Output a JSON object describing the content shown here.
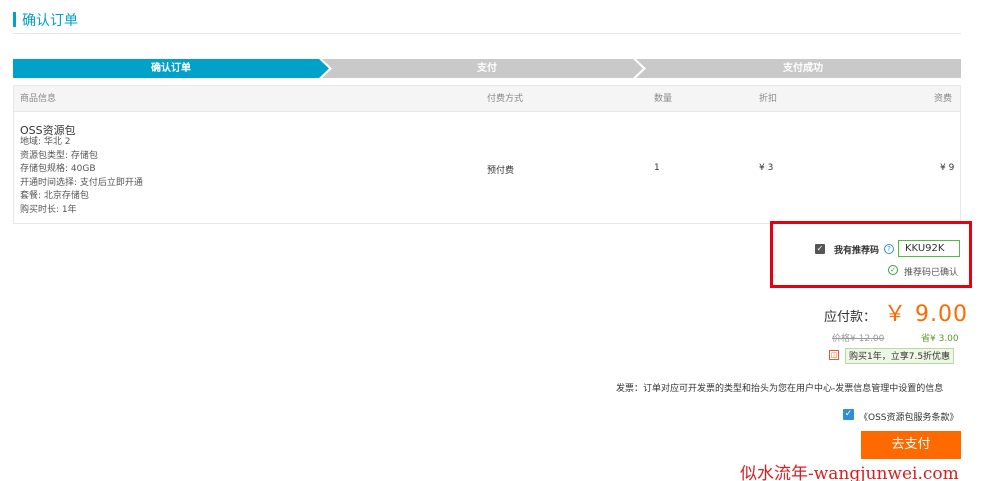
{
  "header": {
    "title": "确认订单"
  },
  "steps": [
    {
      "label": "确认订单",
      "active": true
    },
    {
      "label": "支付",
      "active": false
    },
    {
      "label": "支付成功",
      "active": false
    }
  ],
  "colors": {
    "accent": "#00a2ca",
    "step_inactive": "#c9c9c9",
    "pay_orange": "#ff6a00",
    "highlight_red": "#e60012",
    "input_green": "#58b74b",
    "watermark_red": "#d62020"
  },
  "table": {
    "headers": {
      "product": "商品信息",
      "payment_method": "付费方式",
      "quantity": "数量",
      "discount": "折扣",
      "fee": "资费"
    },
    "row": {
      "name": "OSS资源包",
      "specs": [
        "地域: 华北 2",
        "资源包类型: 存储包",
        "存储包规格: 40GB",
        "开通时间选择: 支付后立即开通",
        "套餐: 北京存储包",
        "购买时长: 1年"
      ],
      "payment_method": "预付费",
      "quantity": "1",
      "discount": "¥ 3",
      "fee": "¥ 9"
    }
  },
  "referral": {
    "label": "我有推荐码",
    "code": "KKU92K",
    "confirmed_text": "推荐码已确认",
    "checked": true
  },
  "summary": {
    "pay_label": "应付款：",
    "pay_amount": "￥ 9.00",
    "original_price": "价格¥ 12.00",
    "saved": "省¥ 3.00",
    "promo": "购买1年，立享7.5折优惠"
  },
  "invoice_text": "发票：订单对应可开发票的类型和抬头为您在用户中心-发票信息管理中设置的信息",
  "terms": {
    "checked": true,
    "label": "《OSS资源包服务条款》"
  },
  "pay_button": "去支付",
  "watermark": "似水流年-wangjunwei.com"
}
